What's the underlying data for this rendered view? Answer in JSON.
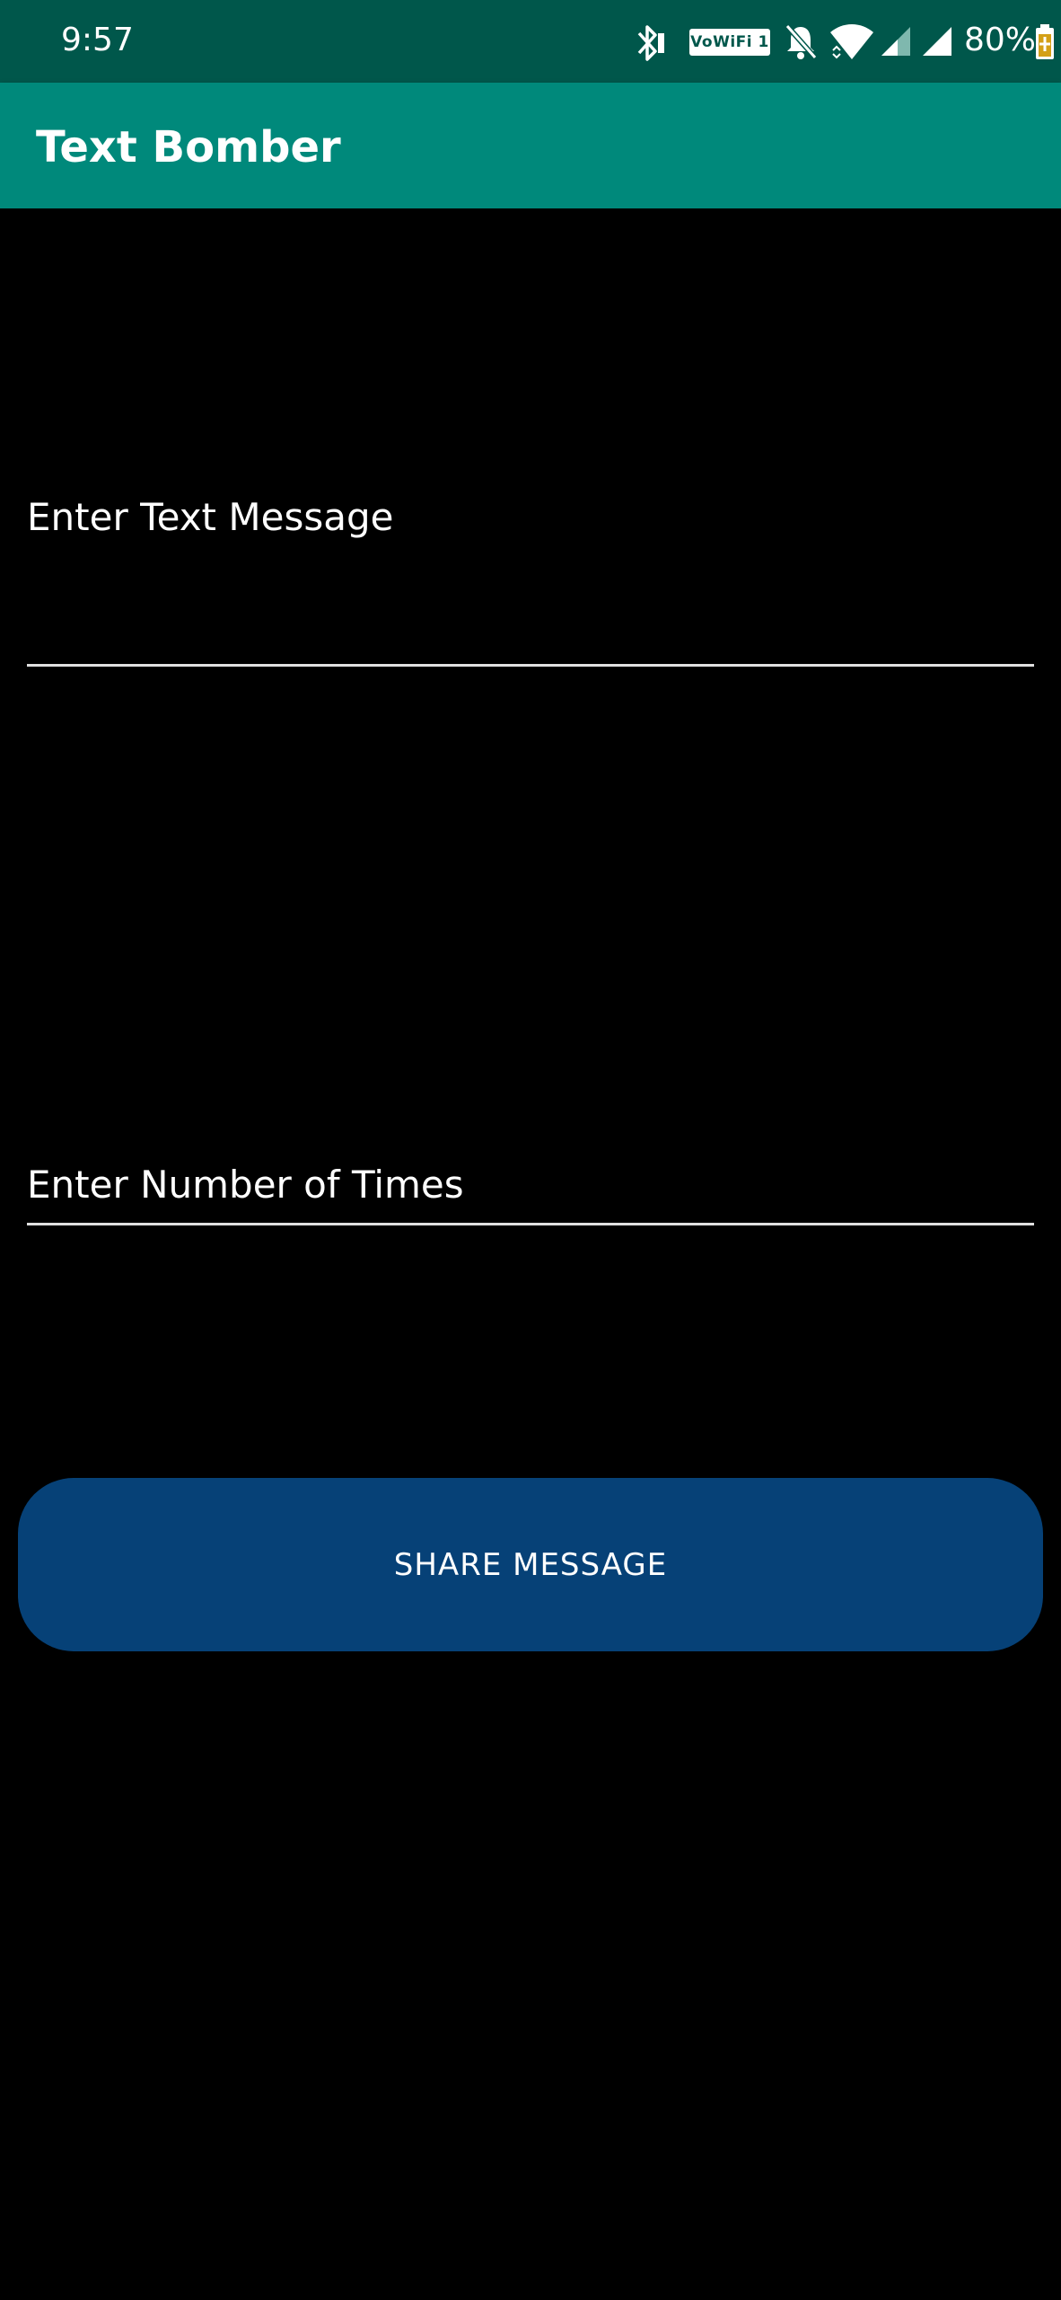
{
  "status_bar": {
    "time": "9:57",
    "vowifi_label": "VoWiFi 1",
    "battery_percent": "80%",
    "icons": [
      "bluetooth-icon",
      "vowifi-icon",
      "bell-muted-icon",
      "wifi-icon",
      "signal-icon",
      "signal-icon",
      "battery-icon"
    ]
  },
  "app_bar": {
    "title": "Text Bomber"
  },
  "form": {
    "message_placeholder": "Enter Text Message",
    "message_value": "",
    "times_placeholder": "Enter Number of Times",
    "times_value": ""
  },
  "actions": {
    "share_label": "SHARE MESSAGE"
  },
  "colors": {
    "status_bar": "#00574B",
    "app_bar": "#00897B",
    "background": "#000000",
    "button": "#064177",
    "text": "#FFFFFF"
  }
}
